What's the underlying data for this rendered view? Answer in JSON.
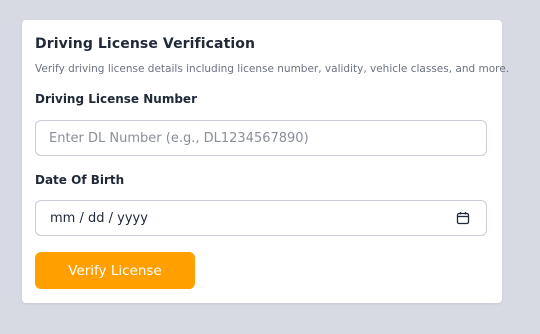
{
  "card": {
    "title": "Driving License Verification",
    "subtitle": "Verify driving license details including license number, validity, vehicle classes, and more."
  },
  "dl_field": {
    "label": "Driving License Number",
    "value": "",
    "placeholder": "Enter DL Number (e.g., DL1234567890)"
  },
  "dob_field": {
    "label": "Date Of Birth",
    "value": "mm / dd / yyyy",
    "icon": "calendar-icon"
  },
  "verify_button": {
    "label": "Verify License"
  },
  "colors": {
    "page_background": "#d7dae3",
    "card_background": "#ffffff",
    "button_accent": "#ffa000",
    "text_primary": "#1f2937",
    "text_muted": "#6b7280"
  }
}
